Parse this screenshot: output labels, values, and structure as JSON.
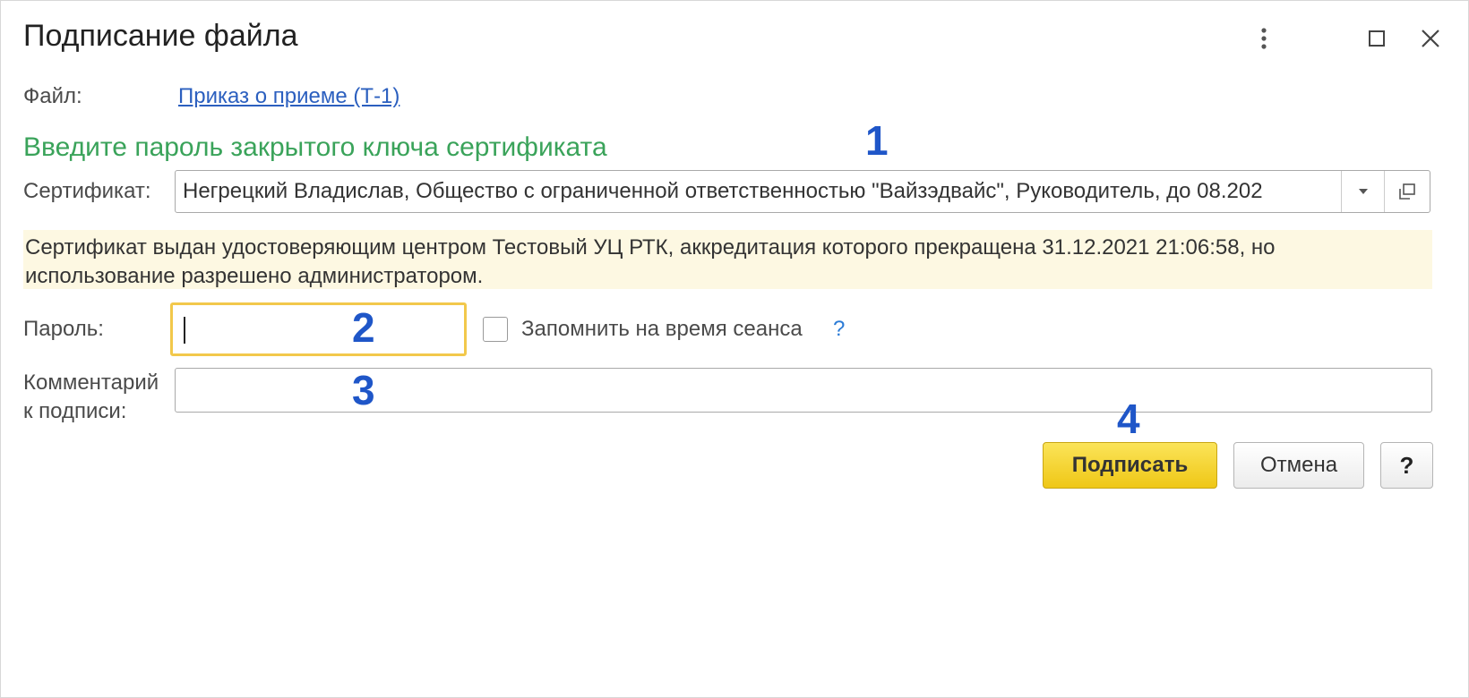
{
  "window": {
    "title": "Подписание файла"
  },
  "file": {
    "label": "Файл:",
    "link": "Приказ о приеме (Т-1)"
  },
  "heading": "Введите пароль закрытого ключа сертификата",
  "certificate": {
    "label": "Сертификат:",
    "value": "Негрецкий Владислав, Общество с ограниченной ответственностью \"Вайзэдвайс\", Руководитель, до 08.202"
  },
  "warning": {
    "line1": "Сертификат выдан удостоверяющим центром Тестовый УЦ РТК, аккредитация которого прекращена 31.12.2021 21:06:58, но",
    "line2": "использование разрешено администратором."
  },
  "password": {
    "label": "Пароль:",
    "value": "",
    "remember_label": "Запомнить на время сеанса",
    "remember_checked": false,
    "help_link": "?"
  },
  "comment": {
    "label_line1": "Комментарий",
    "label_line2": "к подписи:",
    "value": ""
  },
  "buttons": {
    "sign": "Подписать",
    "cancel": "Отмена",
    "help": "?"
  },
  "markers": {
    "m1": "1",
    "m2": "2",
    "m3": "3",
    "m4": "4"
  },
  "colors": {
    "heading_green": "#3aa35a",
    "link_blue": "#2b5fbf",
    "marker_blue": "#1f56c8",
    "warning_bg": "#fdf8e2",
    "primary_yellow": "#f5d535",
    "focus_border": "#f2c84b"
  },
  "icons": {
    "menu": "more-vertical-icon",
    "maximize": "maximize-icon",
    "close": "close-icon",
    "dropdown": "chevron-down-icon",
    "open": "open-window-icon"
  }
}
